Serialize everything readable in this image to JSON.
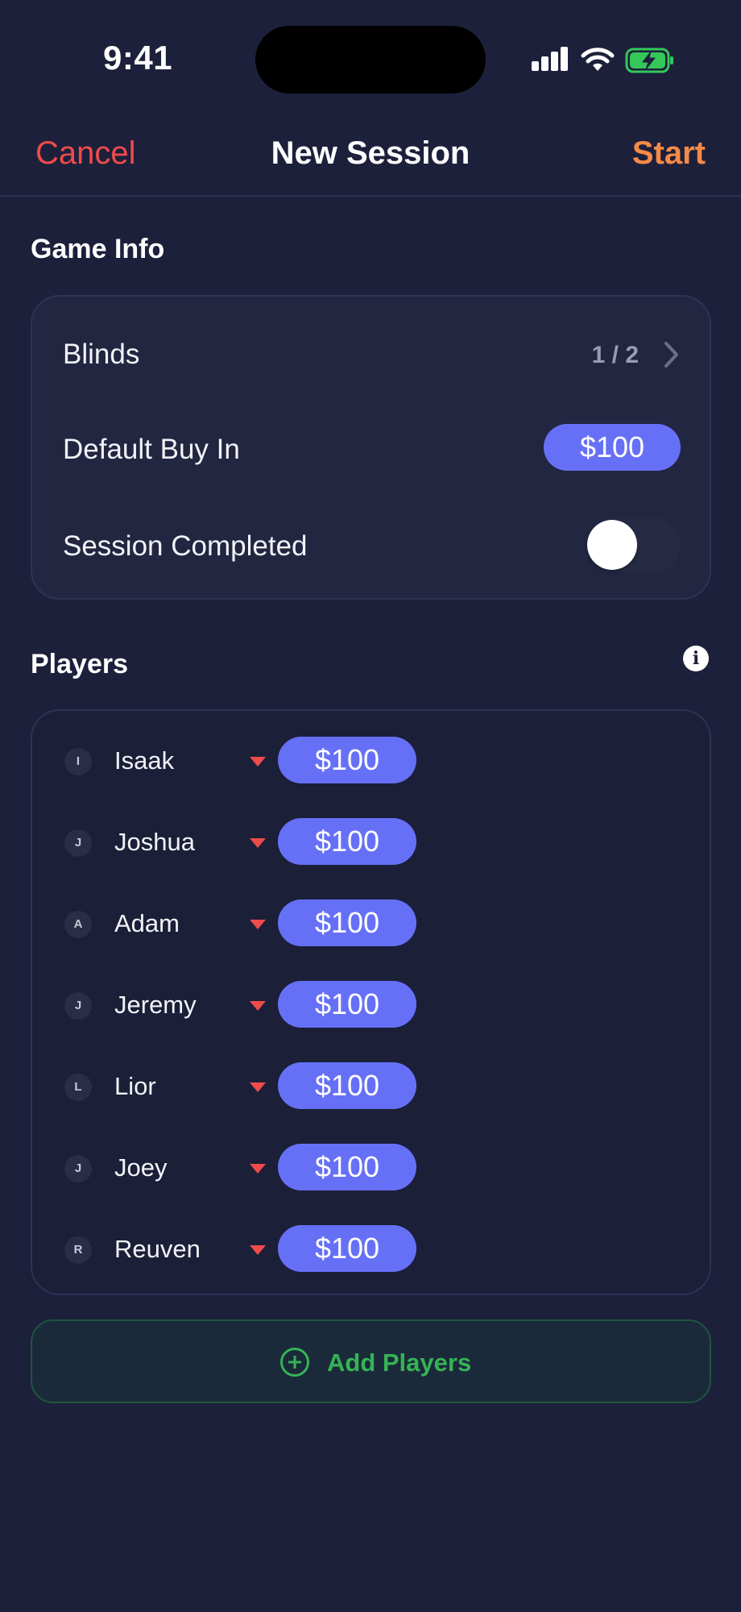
{
  "status_bar": {
    "time": "9:41"
  },
  "nav": {
    "cancel": "Cancel",
    "title": "New Session",
    "start": "Start"
  },
  "game_info": {
    "title": "Game Info",
    "blinds_label": "Blinds",
    "blinds_value": "1 / 2",
    "buy_in_label": "Default Buy In",
    "buy_in_value": "$100",
    "completed_label": "Session Completed",
    "completed_on": false
  },
  "players": {
    "title": "Players",
    "list": [
      {
        "initial": "I",
        "name": "Isaak",
        "amount": "$100"
      },
      {
        "initial": "J",
        "name": "Joshua",
        "amount": "$100"
      },
      {
        "initial": "A",
        "name": "Adam",
        "amount": "$100"
      },
      {
        "initial": "J",
        "name": "Jeremy",
        "amount": "$100"
      },
      {
        "initial": "L",
        "name": "Lior",
        "amount": "$100"
      },
      {
        "initial": "J",
        "name": "Joey",
        "amount": "$100"
      },
      {
        "initial": "R",
        "name": "Reuven",
        "amount": "$100"
      }
    ]
  },
  "add_players": {
    "label": "Add Players"
  },
  "colors": {
    "background": "#1d203b",
    "cancel": "#ef4b4b",
    "start": "#f58a47",
    "pill": "#6670f7",
    "add": "#34b455"
  }
}
